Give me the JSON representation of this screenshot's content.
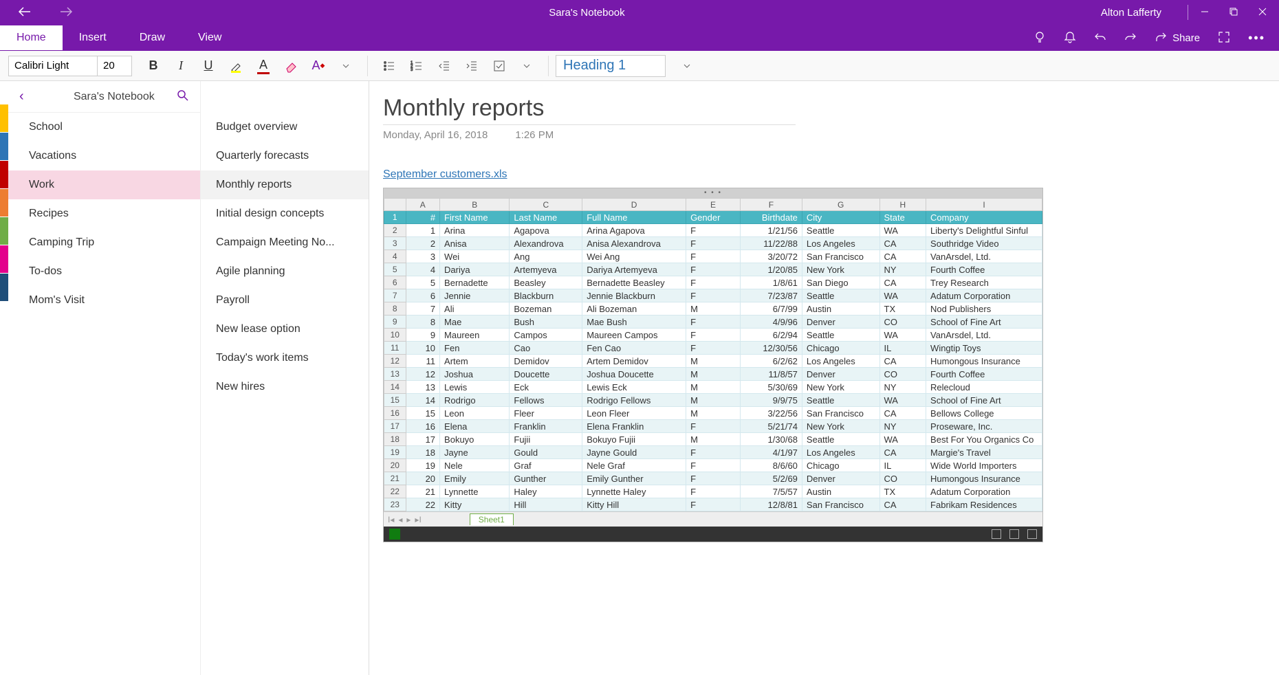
{
  "titlebar": {
    "title": "Sara's Notebook",
    "user": "Alton Lafferty"
  },
  "tabs": [
    "Home",
    "Insert",
    "Draw",
    "View"
  ],
  "active_tab": "Home",
  "share_label": "Share",
  "toolbar": {
    "font": "Calibri Light",
    "size": "20",
    "style": "Heading 1"
  },
  "sidebar": {
    "notebook_title": "Sara's Notebook",
    "sections": [
      "School",
      "Vacations",
      "Work",
      "Recipes",
      "Camping Trip",
      "To-dos",
      "Mom's Visit"
    ],
    "active_section": "Work",
    "section_colors": [
      "c-yellow",
      "c-blue",
      "c-red",
      "c-orange",
      "c-green",
      "c-pink",
      "c-dblue"
    ],
    "pages": [
      "Budget overview",
      "Quarterly forecasts",
      "Monthly reports",
      "Initial design concepts",
      "Campaign Meeting No...",
      "Agile planning",
      "Payroll",
      "New lease option",
      "Today's work items",
      "New hires"
    ],
    "active_page": "Monthly reports"
  },
  "content": {
    "title": "Monthly reports",
    "date": "Monday, April 16, 2018",
    "time": "1:26 PM",
    "attachment": "September customers.xls"
  },
  "spreadsheet": {
    "col_letters": [
      "A",
      "B",
      "C",
      "D",
      "E",
      "F",
      "G",
      "H",
      "I"
    ],
    "headers": [
      "#",
      "First Name",
      "Last Name",
      "Full Name",
      "Gender",
      "Birthdate",
      "City",
      "State",
      "Company"
    ],
    "sheet_name": "Sheet1",
    "rows": [
      [
        "1",
        "Arina",
        "Agapova",
        "Arina Agapova",
        "F",
        "1/21/56",
        "Seattle",
        "WA",
        "Liberty's Delightful Sinful"
      ],
      [
        "2",
        "Anisa",
        "Alexandrova",
        "Anisa Alexandrova",
        "F",
        "11/22/88",
        "Los Angeles",
        "CA",
        "Southridge Video"
      ],
      [
        "3",
        "Wei",
        "Ang",
        "Wei Ang",
        "F",
        "3/20/72",
        "San Francisco",
        "CA",
        "VanArsdel, Ltd."
      ],
      [
        "4",
        "Dariya",
        "Artemyeva",
        "Dariya Artemyeva",
        "F",
        "1/20/85",
        "New York",
        "NY",
        "Fourth Coffee"
      ],
      [
        "5",
        "Bernadette",
        "Beasley",
        "Bernadette Beasley",
        "F",
        "1/8/61",
        "San Diego",
        "CA",
        "Trey Research"
      ],
      [
        "6",
        "Jennie",
        "Blackburn",
        "Jennie Blackburn",
        "F",
        "7/23/87",
        "Seattle",
        "WA",
        "Adatum Corporation"
      ],
      [
        "7",
        "Ali",
        "Bozeman",
        "Ali Bozeman",
        "M",
        "6/7/99",
        "Austin",
        "TX",
        "Nod Publishers"
      ],
      [
        "8",
        "Mae",
        "Bush",
        "Mae Bush",
        "F",
        "4/9/96",
        "Denver",
        "CO",
        "School of Fine Art"
      ],
      [
        "9",
        "Maureen",
        "Campos",
        "Maureen Campos",
        "F",
        "6/2/94",
        "Seattle",
        "WA",
        "VanArsdel, Ltd."
      ],
      [
        "10",
        "Fen",
        "Cao",
        "Fen Cao",
        "F",
        "12/30/56",
        "Chicago",
        "IL",
        "Wingtip Toys"
      ],
      [
        "11",
        "Artem",
        "Demidov",
        "Artem Demidov",
        "M",
        "6/2/62",
        "Los Angeles",
        "CA",
        "Humongous Insurance"
      ],
      [
        "12",
        "Joshua",
        "Doucette",
        "Joshua Doucette",
        "M",
        "11/8/57",
        "Denver",
        "CO",
        "Fourth Coffee"
      ],
      [
        "13",
        "Lewis",
        "Eck",
        "Lewis Eck",
        "M",
        "5/30/69",
        "New York",
        "NY",
        "Relecloud"
      ],
      [
        "14",
        "Rodrigo",
        "Fellows",
        "Rodrigo Fellows",
        "M",
        "9/9/75",
        "Seattle",
        "WA",
        "School of Fine Art"
      ],
      [
        "15",
        "Leon",
        "Fleer",
        "Leon Fleer",
        "M",
        "3/22/56",
        "San Francisco",
        "CA",
        "Bellows College"
      ],
      [
        "16",
        "Elena",
        "Franklin",
        "Elena Franklin",
        "F",
        "5/21/74",
        "New York",
        "NY",
        "Proseware, Inc."
      ],
      [
        "17",
        "Bokuyo",
        "Fujii",
        "Bokuyo Fujii",
        "M",
        "1/30/68",
        "Seattle",
        "WA",
        "Best For You Organics Co"
      ],
      [
        "18",
        "Jayne",
        "Gould",
        "Jayne Gould",
        "F",
        "4/1/97",
        "Los Angeles",
        "CA",
        "Margie's Travel"
      ],
      [
        "19",
        "Nele",
        "Graf",
        "Nele Graf",
        "F",
        "8/6/60",
        "Chicago",
        "IL",
        "Wide World Importers"
      ],
      [
        "20",
        "Emily",
        "Gunther",
        "Emily Gunther",
        "F",
        "5/2/69",
        "Denver",
        "CO",
        "Humongous Insurance"
      ],
      [
        "21",
        "Lynnette",
        "Haley",
        "Lynnette Haley",
        "F",
        "7/5/57",
        "Austin",
        "TX",
        "Adatum Corporation"
      ],
      [
        "22",
        "Kitty",
        "Hill",
        "Kitty Hill",
        "F",
        "12/8/81",
        "San Francisco",
        "CA",
        "Fabrikam Residences"
      ]
    ]
  }
}
